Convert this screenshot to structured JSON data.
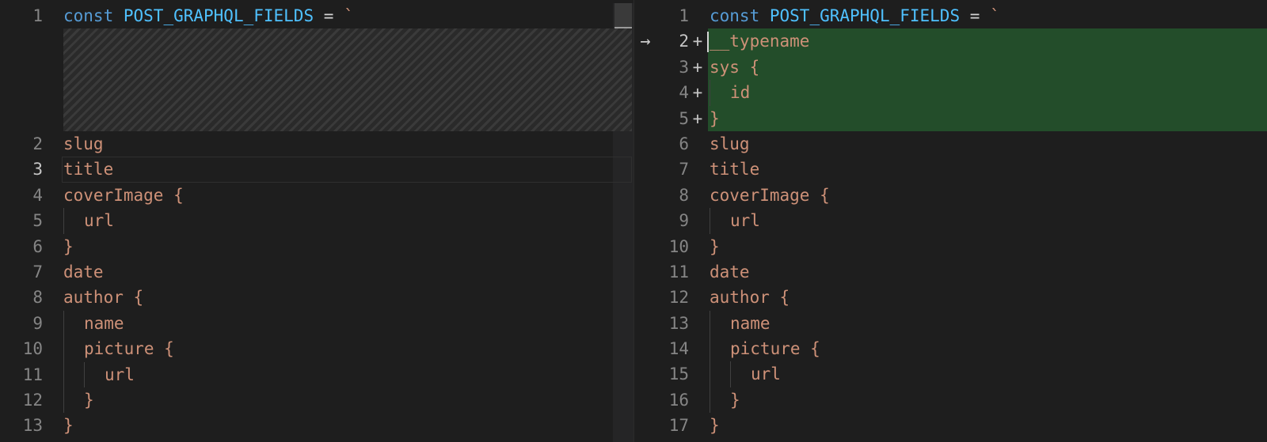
{
  "left": {
    "lines": [
      {
        "num": "1",
        "const_kw": "const",
        "const_name": "POST_GRAPHQL_FIELDS",
        "eq": "=",
        "tick": "`"
      },
      {
        "num": "2",
        "text": "slug"
      },
      {
        "num": "3",
        "text": "title"
      },
      {
        "num": "4",
        "text": "coverImage {"
      },
      {
        "num": "5",
        "text": "url"
      },
      {
        "num": "6",
        "text": "}"
      },
      {
        "num": "7",
        "text": "date"
      },
      {
        "num": "8",
        "text": "author {"
      },
      {
        "num": "9",
        "text": "name"
      },
      {
        "num": "10",
        "text": "picture {"
      },
      {
        "num": "11",
        "text": "url"
      },
      {
        "num": "12",
        "text": "}"
      },
      {
        "num": "13",
        "text": "}"
      }
    ]
  },
  "right": {
    "lines": [
      {
        "num": "1",
        "const_kw": "const",
        "const_name": "POST_GRAPHQL_FIELDS",
        "eq": "=",
        "tick": "`"
      },
      {
        "num": "2",
        "mark": "+",
        "text": "__typename"
      },
      {
        "num": "3",
        "mark": "+",
        "text": "sys {"
      },
      {
        "num": "4",
        "mark": "+",
        "text": "id"
      },
      {
        "num": "5",
        "mark": "+",
        "text": "}"
      },
      {
        "num": "6",
        "text": "slug"
      },
      {
        "num": "7",
        "text": "title"
      },
      {
        "num": "8",
        "text": "coverImage {"
      },
      {
        "num": "9",
        "text": "url"
      },
      {
        "num": "10",
        "text": "}"
      },
      {
        "num": "11",
        "text": "date"
      },
      {
        "num": "12",
        "text": "author {"
      },
      {
        "num": "13",
        "text": "name"
      },
      {
        "num": "14",
        "text": "picture {"
      },
      {
        "num": "15",
        "text": "url"
      },
      {
        "num": "16",
        "text": "}"
      },
      {
        "num": "17",
        "text": "}"
      }
    ]
  },
  "icons": {
    "compare_arrow": "arrow-right-icon"
  },
  "colors": {
    "background": "#1e1e1e",
    "keyword": "#569cd6",
    "constant": "#4fc1ff",
    "string": "#ce9178",
    "added_line_bg": "#234d2a",
    "line_number": "#858585"
  }
}
